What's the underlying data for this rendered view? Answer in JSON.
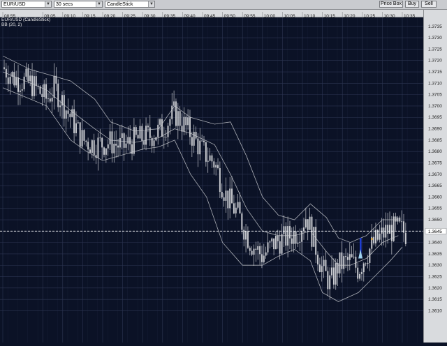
{
  "toolbar": {
    "symbol": "EUR/USD",
    "interval": "30 secs",
    "chart_type": "CandleStick",
    "price_box_label": "Price Box",
    "buy_label": "Buy",
    "sell_label": "Sell"
  },
  "chart_title": "EUR/USD (CandleStick)",
  "indicator_label": "BB (20, 2)",
  "colors": {
    "background": "#0b1226",
    "grid": "#2c3552",
    "candle": "#c9cbd0",
    "band": "#c9cbd0",
    "signal_bar": "#1f3fd6",
    "signal_arrow": "#9fd3f0",
    "marker": "#e8b450",
    "current_price_line": "#ffffff"
  },
  "chart_data": {
    "type": "candlestick",
    "instrument": "EUR/USD",
    "indicator": "Bollinger Bands (20, 2)",
    "time_labels": [
      "09:05",
      "09:10",
      "09:15",
      "09:20",
      "09:25",
      "09:30",
      "09:35",
      "09:40",
      "09:45",
      "09:50",
      "09:55",
      "10:00",
      "10:05",
      "10:10",
      "10:15",
      "10:20",
      "10:25",
      "10:30",
      "10:35"
    ],
    "first_time_label": "08:55",
    "first_time_label_short": "09:00",
    "price_labels": [
      "1.3735",
      "1.3730",
      "1.3725",
      "1.3720",
      "1.3715",
      "1.3710",
      "1.3705",
      "1.3700",
      "1.3695",
      "1.3690",
      "1.3685",
      "1.3680",
      "1.3675",
      "1.3670",
      "1.3665",
      "1.3660",
      "1.3655",
      "1.3650",
      "1.3645",
      "1.3640",
      "1.3635",
      "1.3630",
      "1.3625",
      "1.3620",
      "1.3615",
      "1.3610"
    ],
    "y_range": [
      1.3608,
      1.3738
    ],
    "current_price": 1.3645,
    "close_path": [
      [
        "08:55",
        1.3717
      ],
      [
        "08:58",
        1.3712
      ],
      [
        "09:02",
        1.371
      ],
      [
        "09:06",
        1.3703
      ],
      [
        "09:08",
        1.3708
      ],
      [
        "09:12",
        1.3695
      ],
      [
        "09:15",
        1.3685
      ],
      [
        "09:18",
        1.3683
      ],
      [
        "09:22",
        1.3684
      ],
      [
        "09:25",
        1.3682
      ],
      [
        "09:28",
        1.3685
      ],
      [
        "09:32",
        1.3687
      ],
      [
        "09:35",
        1.369
      ],
      [
        "09:38",
        1.3697
      ],
      [
        "09:42",
        1.3688
      ],
      [
        "09:45",
        1.368
      ],
      [
        "09:48",
        1.3675
      ],
      [
        "09:51",
        1.366
      ],
      [
        "09:54",
        1.3652
      ],
      [
        "09:57",
        1.364
      ],
      [
        "10:00",
        1.3634
      ],
      [
        "10:03",
        1.364
      ],
      [
        "10:06",
        1.3642
      ],
      [
        "10:09",
        1.3645
      ],
      [
        "10:11",
        1.3652
      ],
      [
        "10:13",
        1.364
      ],
      [
        "10:15",
        1.3628
      ],
      [
        "10:17",
        1.3622
      ],
      [
        "10:19",
        1.363
      ],
      [
        "10:22",
        1.3632
      ],
      [
        "10:24",
        1.3628
      ],
      [
        "10:26",
        1.3635
      ],
      [
        "10:28",
        1.364
      ],
      [
        "10:31",
        1.3645
      ],
      [
        "10:34",
        1.3646
      ],
      [
        "10:36",
        1.3644
      ]
    ],
    "bollinger_upper": [
      [
        "08:55",
        1.3722
      ],
      [
        "09:02",
        1.3716
      ],
      [
        "09:06",
        1.3714
      ],
      [
        "09:12",
        1.3711
      ],
      [
        "09:18",
        1.3703
      ],
      [
        "09:22",
        1.3693
      ],
      [
        "09:28",
        1.3689
      ],
      [
        "09:34",
        1.369
      ],
      [
        "09:38",
        1.37
      ],
      [
        "09:42",
        1.3695
      ],
      [
        "09:48",
        1.3692
      ],
      [
        "09:52",
        1.3693
      ],
      [
        "09:56",
        1.3678
      ],
      [
        "10:00",
        1.366
      ],
      [
        "10:04",
        1.3652
      ],
      [
        "10:08",
        1.365
      ],
      [
        "10:12",
        1.3657
      ],
      [
        "10:16",
        1.3651
      ],
      [
        "10:19",
        1.3642
      ],
      [
        "10:22",
        1.364
      ],
      [
        "10:26",
        1.3643
      ],
      [
        "10:30",
        1.365
      ],
      [
        "10:34",
        1.365
      ]
    ],
    "bollinger_lower": [
      [
        "08:55",
        1.3708
      ],
      [
        "09:02",
        1.3703
      ],
      [
        "09:06",
        1.37
      ],
      [
        "09:12",
        1.3685
      ],
      [
        "09:16",
        1.368
      ],
      [
        "09:20",
        1.3676
      ],
      [
        "09:26",
        1.3679
      ],
      [
        "09:30",
        1.3681
      ],
      [
        "09:34",
        1.3682
      ],
      [
        "09:38",
        1.3685
      ],
      [
        "09:42",
        1.367
      ],
      [
        "09:46",
        1.366
      ],
      [
        "09:50",
        1.364
      ],
      [
        "09:55",
        1.363
      ],
      [
        "10:00",
        1.363
      ],
      [
        "10:04",
        1.3634
      ],
      [
        "10:08",
        1.3637
      ],
      [
        "10:12",
        1.3632
      ],
      [
        "10:15",
        1.3618
      ],
      [
        "10:19",
        1.3614
      ],
      [
        "10:24",
        1.3618
      ],
      [
        "10:28",
        1.3625
      ],
      [
        "10:32",
        1.3632
      ],
      [
        "10:35",
        1.3638
      ]
    ],
    "bollinger_middle": [
      [
        "08:55",
        1.3715
      ],
      [
        "09:02",
        1.371
      ],
      [
        "09:06",
        1.3707
      ],
      [
        "09:12",
        1.3698
      ],
      [
        "09:18",
        1.369
      ],
      [
        "09:22",
        1.3685
      ],
      [
        "09:28",
        1.3684
      ],
      [
        "09:34",
        1.3686
      ],
      [
        "09:38",
        1.369
      ],
      [
        "09:42",
        1.3688
      ],
      [
        "09:48",
        1.3683
      ],
      [
        "09:52",
        1.367
      ],
      [
        "09:56",
        1.3655
      ],
      [
        "10:00",
        1.3645
      ],
      [
        "10:04",
        1.3643
      ],
      [
        "10:08",
        1.3643
      ],
      [
        "10:12",
        1.3645
      ],
      [
        "10:16",
        1.3636
      ],
      [
        "10:19",
        1.363
      ],
      [
        "10:22",
        1.363
      ],
      [
        "10:26",
        1.3633
      ],
      [
        "10:30",
        1.364
      ],
      [
        "10:34",
        1.3643
      ]
    ]
  }
}
